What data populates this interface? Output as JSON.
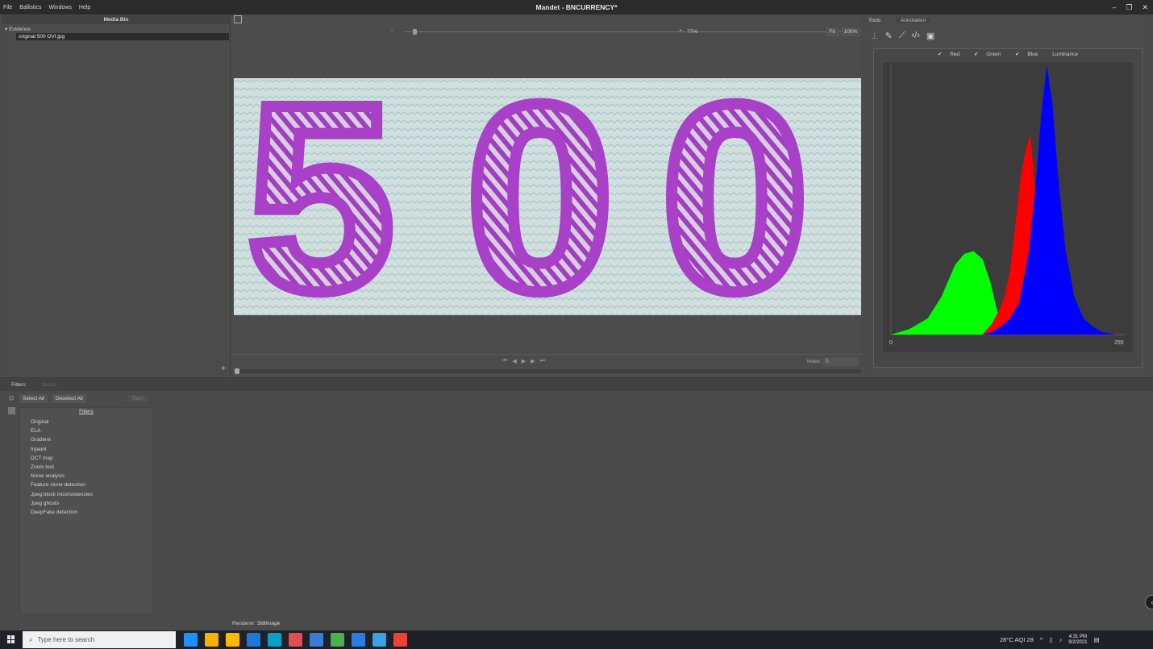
{
  "window": {
    "title": "Mandet - BNCURRENCY*",
    "menu": [
      "File",
      "Ballistics",
      "Windows",
      "Help"
    ],
    "controls": [
      "–",
      "❐",
      "✕"
    ]
  },
  "media_bin": {
    "title": "Media Bin",
    "root": "Evidence",
    "file": "original 500 OVI.jpg",
    "add_label": "+"
  },
  "viewer": {
    "zoom_minus": "-",
    "zoom_plus": "+",
    "zoom_level": "77%",
    "fit_label": "Fit",
    "full_label": "100%",
    "image_digits": [
      "5",
      "0",
      "0"
    ],
    "index_label": "Index:",
    "index_value": "0",
    "transport": [
      "⏮",
      "◀",
      "▶",
      "▶",
      "⏭"
    ],
    "zoom_fraction": 0.03,
    "timeline_fraction": 0.0
  },
  "tools_panel": {
    "tabs": [
      "Tools",
      "Annotation"
    ],
    "channels": [
      {
        "label": "Red",
        "checked": true
      },
      {
        "label": "Green",
        "checked": true
      },
      {
        "label": "Blue",
        "checked": true
      },
      {
        "label": "Luminance",
        "checked": false
      }
    ],
    "histogram_axis": {
      "min_label": "0",
      "max_label": "255"
    }
  },
  "chart_data": {
    "type": "area",
    "title": "",
    "xlabel": "",
    "ylabel": "",
    "xlim": [
      0,
      255
    ],
    "ylim": [
      0,
      1
    ],
    "series": [
      {
        "name": "Green",
        "color": "#00ff00",
        "x": [
          0,
          20,
          40,
          55,
          70,
          80,
          90,
          100,
          108,
          115,
          120,
          130,
          140,
          150,
          160,
          170,
          180,
          200,
          230,
          255
        ],
        "values": [
          0,
          0.02,
          0.06,
          0.14,
          0.26,
          0.3,
          0.31,
          0.28,
          0.2,
          0.1,
          0.04,
          0.01,
          0,
          0,
          0,
          0,
          0,
          0,
          0,
          0
        ]
      },
      {
        "name": "Red",
        "color": "#ff0000",
        "x": [
          0,
          100,
          110,
          118,
          124,
          130,
          136,
          142,
          148,
          152,
          156,
          160,
          170,
          180,
          200,
          255
        ],
        "values": [
          0,
          0,
          0.04,
          0.09,
          0.14,
          0.24,
          0.42,
          0.6,
          0.7,
          0.74,
          0.6,
          0.3,
          0.05,
          0,
          0,
          0
        ],
        "partial": true
      },
      {
        "name": "Blue",
        "color": "#0000ff",
        "x": [
          0,
          100,
          110,
          120,
          130,
          140,
          150,
          158,
          164,
          170,
          176,
          182,
          190,
          200,
          210,
          220,
          230,
          245,
          255
        ],
        "values": [
          0,
          0,
          0.01,
          0.03,
          0.06,
          0.12,
          0.3,
          0.56,
          0.82,
          1.0,
          0.86,
          0.6,
          0.32,
          0.14,
          0.06,
          0.03,
          0.01,
          0,
          0
        ]
      }
    ]
  },
  "filters_panel": {
    "tabs": [
      "Filters",
      "Select"
    ],
    "select_all": "Select All",
    "deselect_all": "Deselect All",
    "start_label": "Start",
    "header": "Filters",
    "items": [
      "Original",
      "ELA",
      "Gradient",
      "Inpaint",
      "DCT map",
      "Zoom test",
      "Noise analysis",
      "Feature clone detection",
      "Jpeg block inconsistencies",
      "Jpeg ghosts",
      "DeepFake detection"
    ]
  },
  "status": {
    "label": "Renderer:",
    "value": "StillImage"
  },
  "taskbar": {
    "search_placeholder": "Type here to search",
    "weather": "28°C  AQI 28",
    "time": "4:31 PM",
    "date": "9/2/2021",
    "app_colors": [
      "#1e90ff",
      "#f2b400",
      "#ffb900",
      "#1e78d7",
      "#0aa0c8",
      "#e05050",
      "#3a7bd5",
      "#4caf50",
      "#2d7de0",
      "#3ba0e8",
      "#ea4335"
    ]
  },
  "colors": {
    "image_magenta": "#b440d0",
    "image_bg": "#cddad6"
  }
}
